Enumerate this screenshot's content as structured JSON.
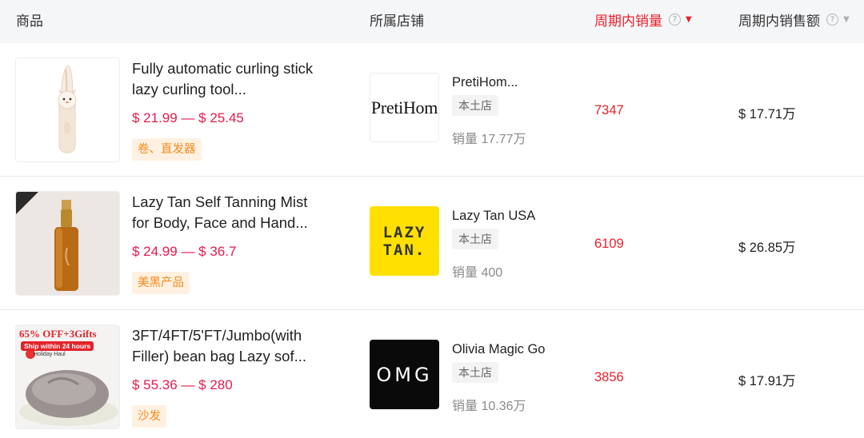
{
  "header": {
    "product": "商品",
    "store": "所属店铺",
    "period_sales": "周期内销量",
    "period_revenue": "周期内销售额",
    "help_icon": "?",
    "sort_active_icon": "▼",
    "sort_inactive_icon": "▼"
  },
  "rows": [
    {
      "title": "Fully automatic curling stick lazy curling tool...",
      "price": "$ 21.99 — $ 25.45",
      "category": "卷、直发器",
      "store_name": "PretiHom...",
      "store_logo_text": "PretiHom",
      "store_type": "本土店",
      "store_sales": "销量 17.77万",
      "sales": "7347",
      "revenue": "$ 17.71万"
    },
    {
      "title": "Lazy Tan Self Tanning Mist for Body, Face and Hand...",
      "price": "$ 24.99 — $ 36.7",
      "category": "美黑产品",
      "store_name": "Lazy Tan USA",
      "store_logo_text_1": "LAZY",
      "store_logo_text_2": "TAN.",
      "store_type": "本土店",
      "store_sales": "销量 400",
      "sales": "6109",
      "revenue": "$ 26.85万"
    },
    {
      "title": "3FT/4FT/5'FT/Jumbo(with Filler) bean bag Lazy sof...",
      "price": "$ 55.36 — $ 280",
      "category": "沙发",
      "store_name": "Olivia Magic Go",
      "store_logo_text": "OMG",
      "store_type": "本土店",
      "store_sales": "销量 10.36万",
      "sales": "3856",
      "revenue": "$ 17.91万",
      "thumb_banner": "65% OFF+3Gifts",
      "thumb_ship": "Ship within 24 hours",
      "thumb_badge": "Holiday Haul"
    }
  ],
  "colors": {
    "accent_red": "#e8202b",
    "price_red": "#e31b4e",
    "tag_orange": "#f38a1d",
    "header_bg": "#f5f6f8"
  }
}
